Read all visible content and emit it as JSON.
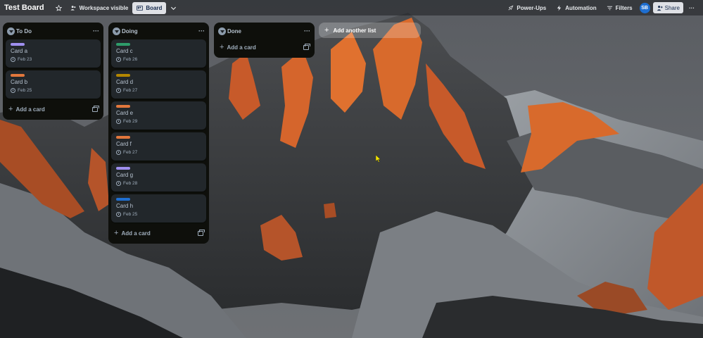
{
  "board": {
    "title": "Test Board",
    "visibility_label": "Workspace visible",
    "view_label": "Board"
  },
  "toolbar": {
    "powerups_label": "Power-Ups",
    "automation_label": "Automation",
    "filters_label": "Filters",
    "avatar_initials": "SB",
    "share_label": "Share",
    "more_label": "···"
  },
  "lists": [
    {
      "title": "To Do",
      "menu": "···",
      "add_card_label": "Add a card",
      "cards": [
        {
          "title": "Card a",
          "date": "Feb 23",
          "label_color": "#9f8fef"
        },
        {
          "title": "Card b",
          "date": "Feb 25",
          "label_color": "#e2773c"
        }
      ]
    },
    {
      "title": "Doing",
      "menu": "···",
      "add_card_label": "Add a card",
      "cards": [
        {
          "title": "Card c",
          "date": "Feb 26",
          "label_color": "#2e9c6a"
        },
        {
          "title": "Card d",
          "date": "Feb 27",
          "label_color": "#b38600"
        },
        {
          "title": "Card e",
          "date": "Feb 29",
          "label_color": "#e2773c"
        },
        {
          "title": "Card f",
          "date": "Feb 27",
          "label_color": "#e2773c"
        },
        {
          "title": "Card g",
          "date": "Feb 28",
          "label_color": "#9f8fef"
        },
        {
          "title": "Card h",
          "date": "Feb 25",
          "label_color": "#1f6fd1"
        }
      ]
    },
    {
      "title": "Done",
      "menu": "···",
      "add_card_label": "Add a card",
      "cards": []
    }
  ],
  "add_list_label": "Add another list",
  "colors": {
    "list_bg": "#0e0f0b",
    "card_bg": "#22272b",
    "accent_avatar": "#1f6fd1"
  }
}
